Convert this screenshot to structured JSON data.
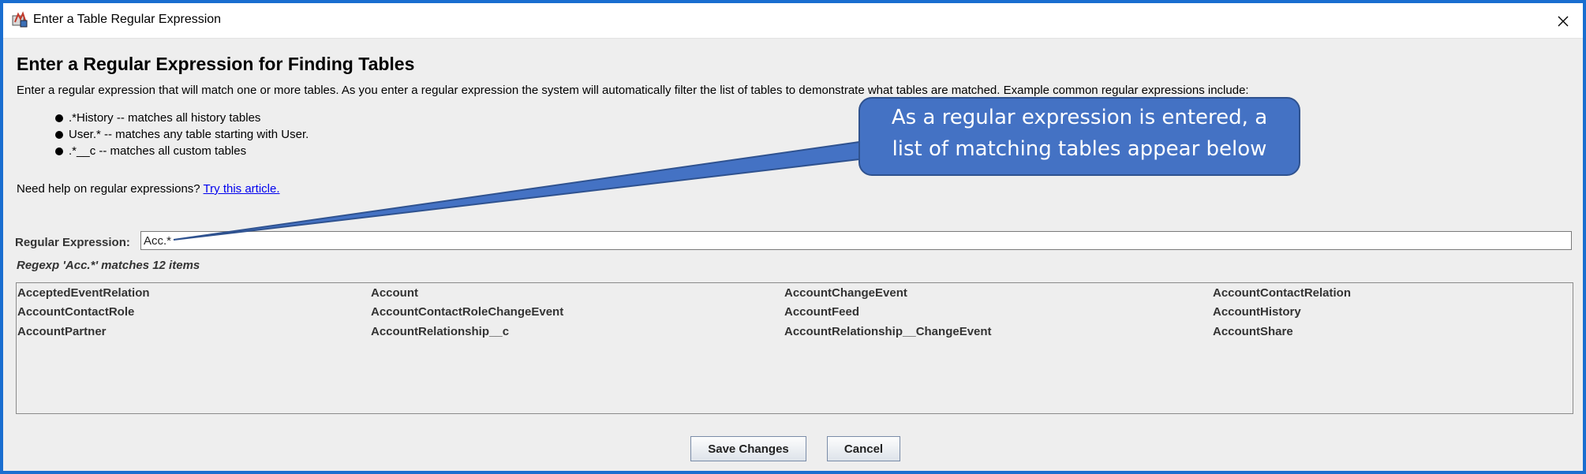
{
  "window": {
    "title": "Enter a Table Regular Expression",
    "app_icon": "java-app-icon",
    "close_icon": "close-icon"
  },
  "dialog": {
    "heading": "Enter a Regular Expression for Finding Tables",
    "intro": "Enter a regular expression that will match one or more tables. As you enter a regular expression the system will automatically filter the list of tables to demonstrate what tables are matched. Example common regular expressions include:",
    "examples": [
      ".*History -- matches all history tables",
      "User.* -- matches any table starting with User.",
      ".*__c -- matches all custom tables"
    ],
    "help_prefix": "Need help on regular expressions? ",
    "help_link": "Try this article.",
    "regex_label": "Regular Expression:",
    "regex_value": "Acc.*",
    "match_summary": "Regexp 'Acc.*' matches 12 items",
    "tables": [
      [
        "AcceptedEventRelation",
        "Account",
        "AccountChangeEvent",
        "AccountContactRelation"
      ],
      [
        "AccountContactRole",
        "AccountContactRoleChangeEvent",
        "AccountFeed",
        "AccountHistory"
      ],
      [
        "AccountPartner",
        "AccountRelationship__c",
        "AccountRelationship__ChangeEvent",
        "AccountShare"
      ]
    ],
    "save_label": "Save Changes",
    "cancel_label": "Cancel"
  },
  "callout": {
    "line1": "As a regular expression is entered, a",
    "line2": "list of matching tables appear below",
    "fill_color": "#4472c4",
    "border_color": "#2f528f"
  },
  "colors": {
    "window_border": "#1a6ed0",
    "link": "#0000ee"
  }
}
